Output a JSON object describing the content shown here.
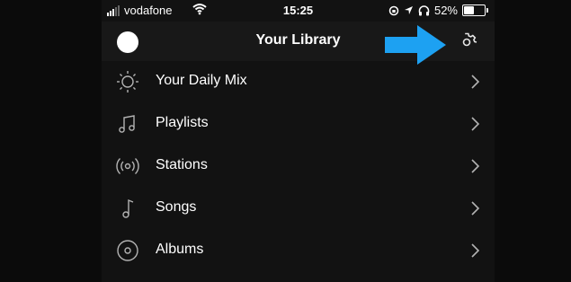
{
  "status_bar": {
    "carrier": "vodafone",
    "time": "15:25",
    "battery_percent": "52%",
    "battery_level": 0.52,
    "signal_bars_filled": 3,
    "signal_bars_total": 5
  },
  "header": {
    "title": "Your Library",
    "settings_icon": "gear-icon",
    "avatar_icon": "avatar"
  },
  "library_items": [
    {
      "label": "Your Daily Mix",
      "icon": "sun-icon"
    },
    {
      "label": "Playlists",
      "icon": "music-note-double-icon"
    },
    {
      "label": "Stations",
      "icon": "radio-waves-icon"
    },
    {
      "label": "Songs",
      "icon": "music-note-icon"
    },
    {
      "label": "Albums",
      "icon": "disc-icon"
    }
  ],
  "colors": {
    "background": "#121212",
    "header_bg": "#181818",
    "text": "#ffffff",
    "icon": "#b3b3b3",
    "callout_arrow": "#1da1f2"
  }
}
